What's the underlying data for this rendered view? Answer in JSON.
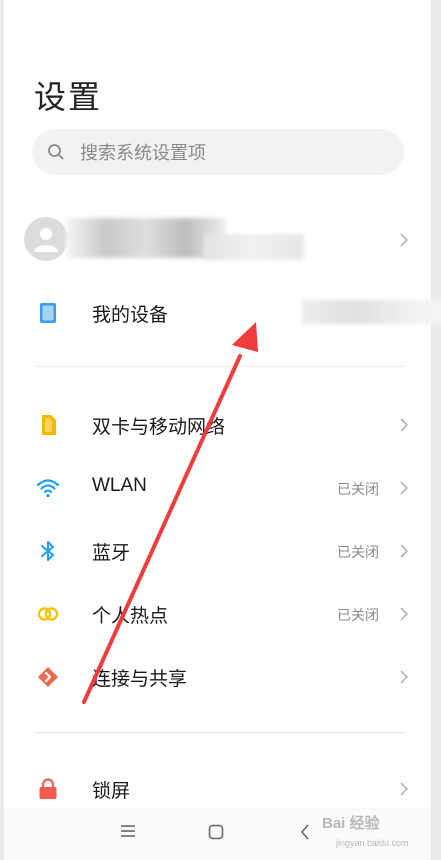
{
  "page": {
    "title": "设置"
  },
  "search": {
    "placeholder": "搜索系统设置项"
  },
  "items": [
    {
      "label": "我的设备",
      "status": ""
    },
    {
      "label": "双卡与移动网络",
      "status": ""
    },
    {
      "label": "WLAN",
      "status": "已关闭"
    },
    {
      "label": "蓝牙",
      "status": "已关闭"
    },
    {
      "label": "个人热点",
      "status": "已关闭"
    },
    {
      "label": "连接与共享",
      "status": ""
    },
    {
      "label": "锁屏",
      "status": ""
    }
  ],
  "watermark": {
    "main": "Bai 经验",
    "sub": "jingyan.baidu.com"
  },
  "colors": {
    "device_icon": "#3d9be9",
    "sim_icon": "#f7b500",
    "wifi_icon": "#1ea0f2",
    "bluetooth_icon": "#1ea0f2",
    "hotspot_icon": "#f5c400",
    "share_icon": "#ee6a4e",
    "lock_icon": "#f05a50",
    "annotation_arrow": "#f03c3c"
  },
  "icons": [
    "search-icon",
    "avatar-icon",
    "device-icon",
    "sim-card-icon",
    "wifi-icon",
    "bluetooth-icon",
    "hotspot-icon",
    "share-icon",
    "lock-icon",
    "chevron-right-icon",
    "menu-icon",
    "home-icon",
    "back-icon"
  ]
}
